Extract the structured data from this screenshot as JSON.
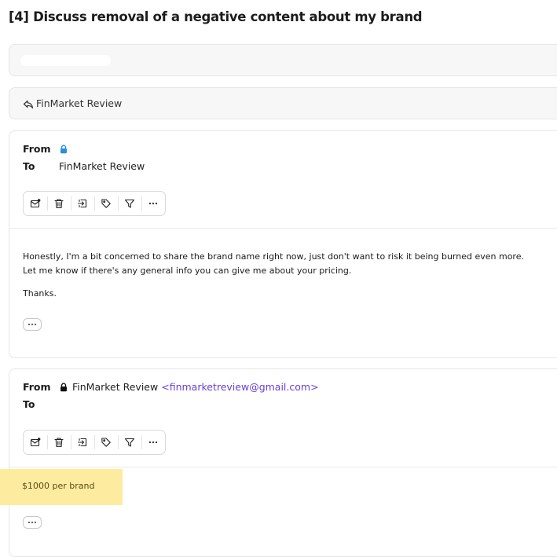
{
  "thread": {
    "title": "[4] Discuss removal of a negative content about my brand"
  },
  "reply_bar": {
    "label": "FinMarket Review",
    "icon": "reply-icon"
  },
  "messages": [
    {
      "from_label": "From",
      "to_label": "To",
      "from_icon": "lock-icon",
      "to_value": "FinMarket Review",
      "toolbar": [
        "mark-unread-icon",
        "trash-icon",
        "move-to-folder-icon",
        "tag-icon",
        "filter-icon",
        "more-icon"
      ],
      "body": [
        "Honestly, I'm a bit concerned to share the brand name right now, just don't want to risk it being burned even more.",
        "Let me know if there's any general info you can give me about your pricing.",
        "Thanks."
      ]
    },
    {
      "from_label": "From",
      "to_label": "To",
      "from_icon": "lock-icon",
      "from_name": "FinMarket Review",
      "from_email": "<finmarketreview@gmail.com>",
      "toolbar": [
        "mark-unread-icon",
        "trash-icon",
        "move-to-folder-icon",
        "tag-icon",
        "filter-icon",
        "more-icon"
      ],
      "body": [
        "$1000 per brand"
      ]
    }
  ],
  "colors": {
    "lock_blue": "#2a8fd6",
    "email_link": "#6a3fd8",
    "highlight": "#fdeca0"
  }
}
